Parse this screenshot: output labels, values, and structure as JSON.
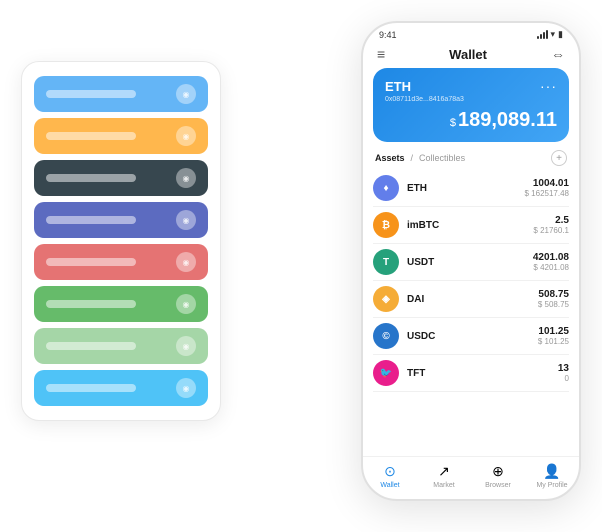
{
  "scene": {
    "cards": [
      {
        "color": "card-blue",
        "label": ""
      },
      {
        "color": "card-yellow",
        "label": ""
      },
      {
        "color": "card-dark",
        "label": ""
      },
      {
        "color": "card-purple",
        "label": ""
      },
      {
        "color": "card-red",
        "label": ""
      },
      {
        "color": "card-green",
        "label": ""
      },
      {
        "color": "card-light-green",
        "label": ""
      },
      {
        "color": "card-sky",
        "label": ""
      }
    ]
  },
  "phone": {
    "status_time": "9:41",
    "header_title": "Wallet",
    "eth_card": {
      "title": "ETH",
      "address": "0x08711d3e...8416a78a3",
      "balance_prefix": "$",
      "balance": "189,089.11"
    },
    "assets_tab": "Assets",
    "slash": "/",
    "collectibles_tab": "Collectibles",
    "add_icon": "+",
    "assets": [
      {
        "name": "ETH",
        "amount": "1004.01",
        "usd": "$ 162517.48",
        "color": "#627EEA",
        "symbol": "♦"
      },
      {
        "name": "imBTC",
        "amount": "2.5",
        "usd": "$ 21760.1",
        "color": "#F7931A",
        "symbol": "₿"
      },
      {
        "name": "USDT",
        "amount": "4201.08",
        "usd": "$ 4201.08",
        "color": "#26A17B",
        "symbol": "T"
      },
      {
        "name": "DAI",
        "amount": "508.75",
        "usd": "$ 508.75",
        "color": "#F5AC37",
        "symbol": "◈"
      },
      {
        "name": "USDC",
        "amount": "101.25",
        "usd": "$ 101.25",
        "color": "#2775CA",
        "symbol": "©"
      },
      {
        "name": "TFT",
        "amount": "13",
        "usd": "0",
        "color": "#e91e8c",
        "symbol": "🐦"
      }
    ],
    "nav": [
      {
        "label": "Wallet",
        "icon": "⊙",
        "active": true
      },
      {
        "label": "Market",
        "icon": "↗",
        "active": false
      },
      {
        "label": "Browser",
        "icon": "⊕",
        "active": false
      },
      {
        "label": "My Profile",
        "icon": "👤",
        "active": false
      }
    ]
  }
}
